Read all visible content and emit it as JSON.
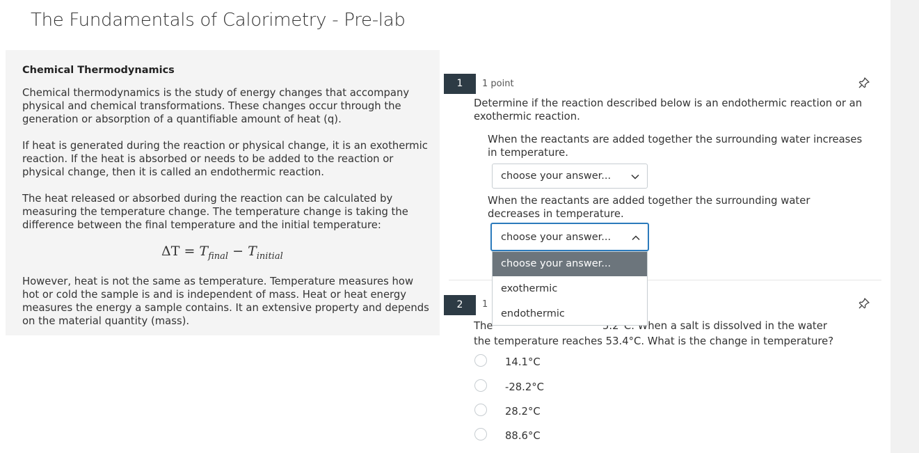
{
  "page": {
    "title": "The Fundamentals of Calorimetry - Pre-lab"
  },
  "reading": {
    "section_title": "Chemical Thermodynamics",
    "paragraphs": [
      "Chemical thermodynamics is the study of energy changes that accompany physical and chemical transformations.  These changes occur through the generation or absorption of a quantifiable amount of heat (q).",
      "If heat is generated during the reaction or physical change, it is an exothermic reaction.  If the heat is absorbed or needs to be added to the reaction or physical change, then it is called an endothermic reaction.",
      "The heat released or absorbed during the reaction can be calculated by measuring the temperature change.  The temperature change is taking the difference between the final temperature and the initial temperature:",
      "However, heat is not the same as temperature.  Temperature measures how hot or cold the sample is and is independent of mass.  Heat or heat energy measures the energy a sample contains.  It an extensive property and depends on the material quantity (mass)."
    ],
    "formula": {
      "delta": "ΔT",
      "equals": "=",
      "t1": "T",
      "t1_sub": "final",
      "minus": "−",
      "t2": "T",
      "t2_sub": "initial"
    }
  },
  "q1": {
    "number": "1",
    "points": "1 point",
    "prompt": "Determine if the reaction described below is an endothermic reaction or an exothermic reaction.",
    "part1": "When the reactants are added together the surrounding water increases in temperature.",
    "part2": "When the reactants are added together the surrounding water decreases in temperature.",
    "select1_value": "choose your answer...",
    "select2_value": "choose your answer...",
    "options": [
      "choose your answer...",
      "exothermic",
      "endothermic"
    ]
  },
  "q2": {
    "number": "2",
    "points_partial": "1",
    "prompt_line1_pre": "The",
    "prompt_line1_post": "5.2°C.  When a salt is dissolved in the water",
    "prompt_line2": "the temperature reaches 53.4°C.  What is the change in temperature?",
    "answers": [
      "14.1°C",
      "-28.2°C",
      "28.2°C",
      "88.6°C"
    ]
  },
  "colors": {
    "question_number_bg": "#2d3b45",
    "focus_border": "#2b7abc",
    "selected_option_bg": "#6c757c",
    "reading_bg": "#f4f4f4"
  },
  "icons": {
    "pin": "pin-icon",
    "chevron_down": "chevron-down-icon",
    "chevron_up": "chevron-up-icon"
  }
}
